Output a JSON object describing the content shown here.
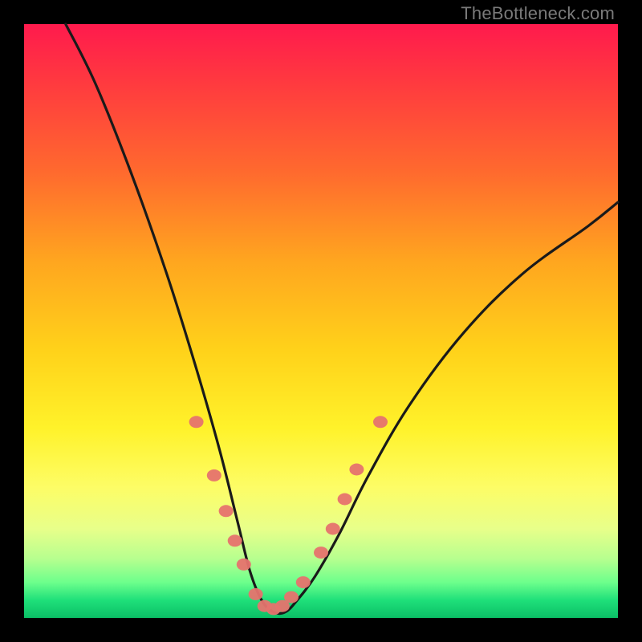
{
  "watermark": "TheBottleneck.com",
  "colors": {
    "frame": "#000000",
    "curve": "#1a1a1a",
    "markers": "#e6736e",
    "gradient_top": "#ff1a4d",
    "gradient_bottom": "#0bbf66"
  },
  "chart_data": {
    "type": "line",
    "title": "",
    "xlabel": "",
    "ylabel": "",
    "xlim": [
      0,
      100
    ],
    "ylim": [
      0,
      100
    ],
    "grid": false,
    "legend": false,
    "description": "V-shaped bottleneck curve over red-to-green vertical gradient. Minimum (best/green) near x≈40. Salmon-colored markers placed along lower portions of both arms and across the flat bottom.",
    "series": [
      {
        "name": "bottleneck-curve",
        "x": [
          7,
          12,
          18,
          24,
          29,
          33,
          36,
          38,
          40,
          42,
          44,
          46,
          49,
          53,
          58,
          65,
          74,
          84,
          95,
          100
        ],
        "y": [
          100,
          90,
          75,
          58,
          42,
          28,
          16,
          8,
          3,
          1,
          1,
          3,
          7,
          14,
          24,
          36,
          48,
          58,
          66,
          70
        ]
      }
    ],
    "markers": [
      {
        "x": 29,
        "y": 33
      },
      {
        "x": 32,
        "y": 24
      },
      {
        "x": 34,
        "y": 18
      },
      {
        "x": 35.5,
        "y": 13
      },
      {
        "x": 37,
        "y": 9
      },
      {
        "x": 39,
        "y": 4
      },
      {
        "x": 40.5,
        "y": 2
      },
      {
        "x": 42,
        "y": 1.5
      },
      {
        "x": 43.5,
        "y": 2
      },
      {
        "x": 45,
        "y": 3.5
      },
      {
        "x": 47,
        "y": 6
      },
      {
        "x": 50,
        "y": 11
      },
      {
        "x": 52,
        "y": 15
      },
      {
        "x": 54,
        "y": 20
      },
      {
        "x": 56,
        "y": 25
      },
      {
        "x": 60,
        "y": 33
      }
    ]
  }
}
